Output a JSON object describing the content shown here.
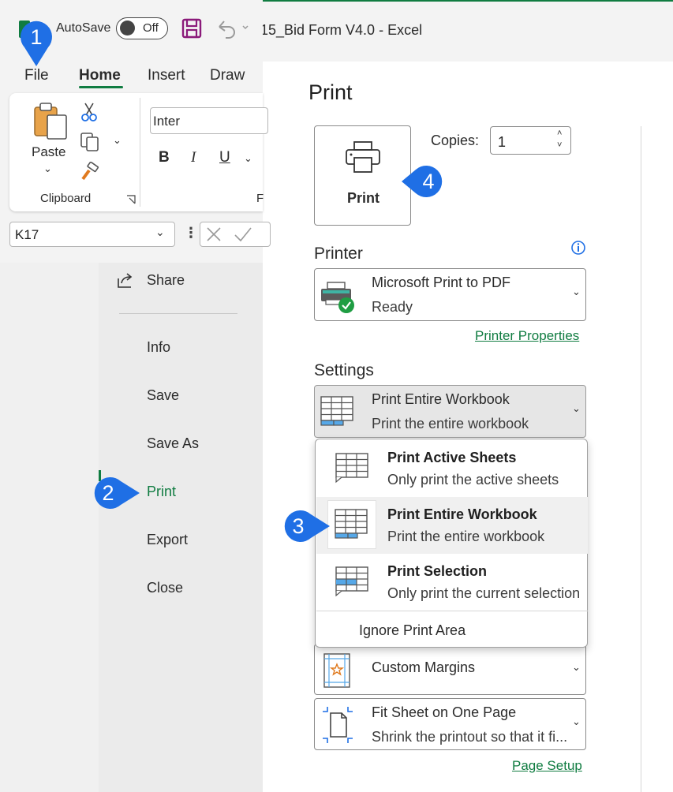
{
  "window": {
    "title": "15_Bid Form V4.0  -  Excel",
    "autosave_label": "AutoSave",
    "autosave_state": "Off"
  },
  "ribbon": {
    "tabs": [
      {
        "label": "File"
      },
      {
        "label": "Home"
      },
      {
        "label": "Insert"
      },
      {
        "label": "Draw"
      }
    ],
    "paste_label": "Paste",
    "clipboard_group_label": "Clipboard",
    "font_group_label_fragment": "F",
    "font_name": "Inter",
    "bold_label": "B",
    "italic_label": "I",
    "underline_label": "U",
    "name_box_value": "K17"
  },
  "backstage_nav": {
    "items": [
      {
        "label": "Share"
      },
      {
        "label": "Info"
      },
      {
        "label": "Save"
      },
      {
        "label": "Save As"
      },
      {
        "label": "Print"
      },
      {
        "label": "Export"
      },
      {
        "label": "Close"
      }
    ],
    "active": "Print"
  },
  "print_pane": {
    "title": "Print",
    "print_button_label": "Print",
    "copies_label": "Copies:",
    "copies_value": "1",
    "printer_heading": "Printer",
    "printer_name": "Microsoft Print to PDF",
    "printer_status": "Ready",
    "printer_properties_link": "Printer Properties",
    "settings_heading": "Settings",
    "settings_selected": {
      "title": "Print Entire Workbook",
      "subtitle": "Print the entire workbook"
    },
    "settings_menu": {
      "items": [
        {
          "title": "Print Active Sheets",
          "subtitle": "Only print the active sheets"
        },
        {
          "title": "Print Entire Workbook",
          "subtitle": "Print the entire workbook"
        },
        {
          "title": "Print Selection",
          "subtitle": "Only print the current selection"
        }
      ],
      "ignore_print_area_label": "Ignore Print Area"
    },
    "margins_label": "Custom Margins",
    "scaling_title": "Fit Sheet on One Page",
    "scaling_subtitle": "Shrink the printout so that it fi...",
    "page_setup_link": "Page Setup"
  },
  "callouts": [
    "1",
    "2",
    "3",
    "4"
  ],
  "colors": {
    "accent": "#107c41",
    "callout": "#1f6fe5"
  }
}
